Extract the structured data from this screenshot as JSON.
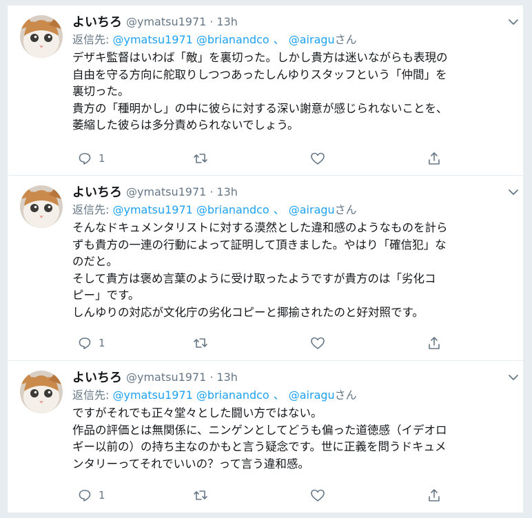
{
  "tweets": [
    {
      "name": "よいちろ",
      "handle": "@ymatsu1971",
      "separator": "·",
      "time": "13h",
      "reply_prefix": "返信先: ",
      "reply_users": [
        "@ymatsu1971",
        "@brianandco"
      ],
      "reply_sep": "、",
      "reply_last": "@airagu",
      "reply_suffix": "さん",
      "text_lines": [
        "デザキ監督はいわば「敵」を裏切った。しかし貴方は迷いながらも表現の",
        "自由を守る方向に舵取りしつつあったしんゆりスタッフという「仲間」を",
        "裏切った。",
        "貴方の「種明かし」の中に彼らに対する深い謝意が感じられないことを、",
        "萎縮した彼らは多分責められないでしょう。"
      ],
      "reply_count": "1"
    },
    {
      "name": "よいちろ",
      "handle": "@ymatsu1971",
      "separator": "·",
      "time": "13h",
      "reply_prefix": "返信先: ",
      "reply_users": [
        "@ymatsu1971",
        "@brianandco"
      ],
      "reply_sep": "、",
      "reply_last": "@airagu",
      "reply_suffix": "さん",
      "text_lines": [
        "そんなドキュメンタリストに対する漠然とした違和感のようなものを計ら",
        "ずも貴方の一連の行動によって証明して頂きました。やはり「確信犯」な",
        "のだと。",
        "そして貴方は褒め言葉のように受け取ったようですが貴方のは「劣化コ",
        "ピー」です。",
        "しんゆりの対応が文化庁の劣化コピーと揶揄されたのと好対照です。"
      ],
      "reply_count": "1"
    },
    {
      "name": "よいちろ",
      "handle": "@ymatsu1971",
      "separator": "·",
      "time": "13h",
      "reply_prefix": "返信先: ",
      "reply_users": [
        "@ymatsu1971",
        "@brianandco"
      ],
      "reply_sep": "、",
      "reply_last": "@airagu",
      "reply_suffix": "さん",
      "text_lines": [
        "ですがそれでも正々堂々とした闘い方ではない。",
        "作品の評価とは無関係に、ニンゲンとしてどうも偏った道徳感（イデオロ",
        "ギー以前の）の持ち主なのかもと言う疑念です。世に正義を問うドキュメ",
        "ンタリーってそれでいいの？って言う違和感。"
      ],
      "reply_count": "1"
    }
  ],
  "icons": {
    "avatar": "cat-avatar",
    "menu": "chevron-down-icon",
    "reply": "reply-icon",
    "retweet": "retweet-icon",
    "like": "heart-icon",
    "share": "share-icon"
  },
  "colors": {
    "link": "#1da1f2",
    "secondary": "#657786",
    "text": "#14171a",
    "background": "#e6ecf0"
  }
}
